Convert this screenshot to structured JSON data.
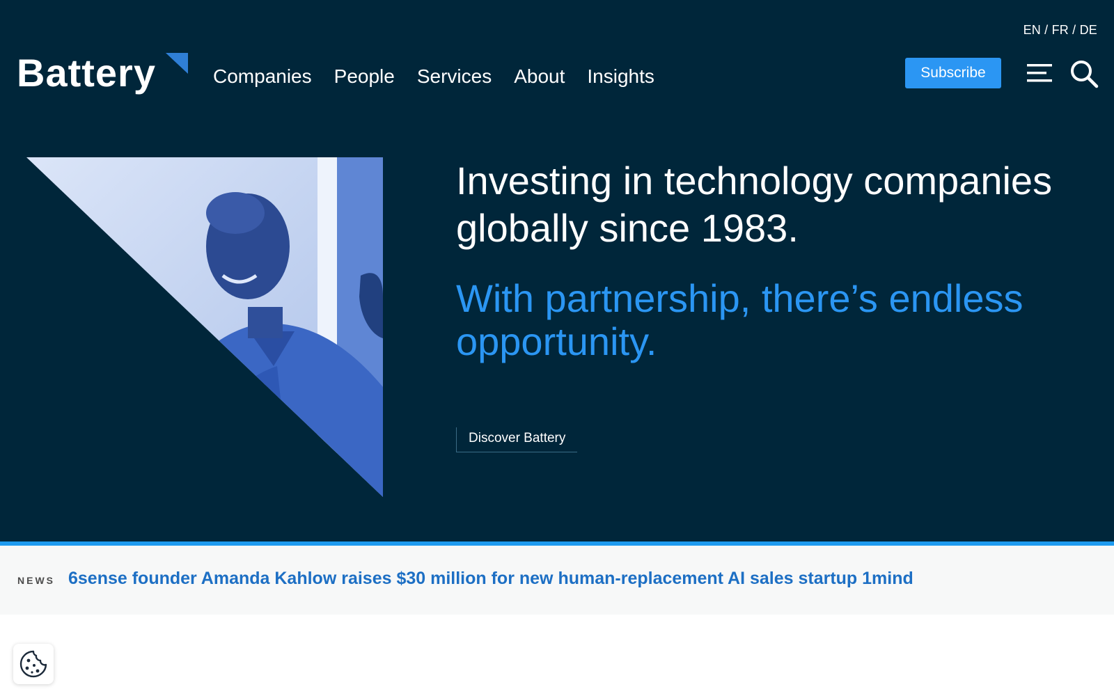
{
  "header": {
    "logo_text": "Battery",
    "languages": [
      "EN",
      "FR",
      "DE"
    ],
    "lang_separator": " / ",
    "nav": [
      "Companies",
      "People",
      "Services",
      "About",
      "Insights"
    ],
    "subscribe_label": "Subscribe",
    "icons": {
      "menu": "hamburger-menu-icon",
      "search": "search-icon"
    }
  },
  "hero": {
    "headline": "Investing in technology companies globally since 1983.",
    "subheadline": "With partnership, there’s endless opportunity.",
    "cta_label": "Discover Battery"
  },
  "news": {
    "label": "NEWS",
    "headline": "6sense founder Amanda Kahlow raises $30 million for new human-replacement AI sales startup 1mind"
  },
  "cookie": {
    "icon": "cookie-icon"
  },
  "colors": {
    "background": "#00263a",
    "accent": "#2b96f3",
    "news_bar_border": "#1e9bf0",
    "news_link": "#1d6fc4",
    "news_bg": "#f7f8f8"
  }
}
